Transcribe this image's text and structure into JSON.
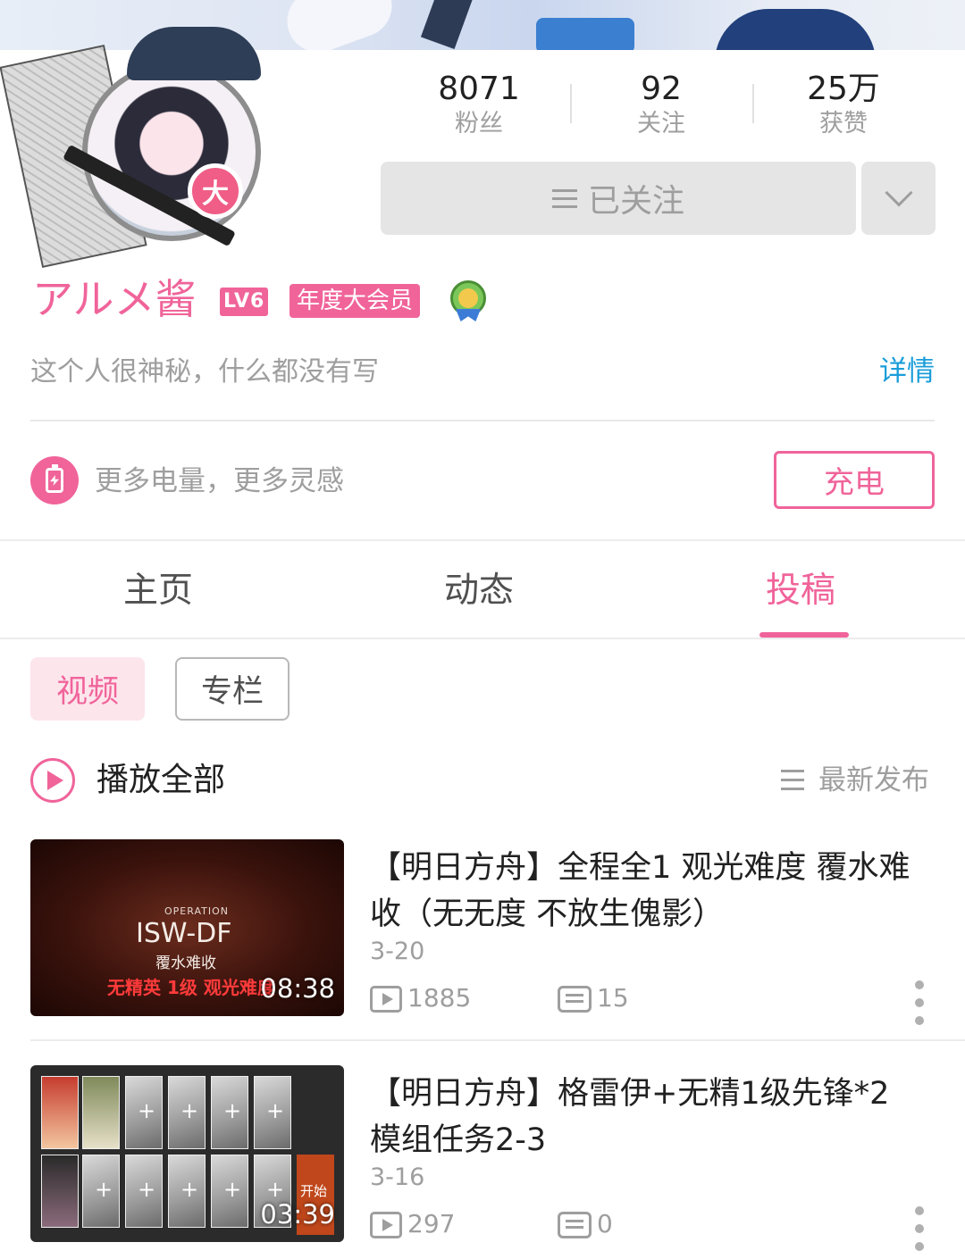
{
  "profile": {
    "avatar_badge": "大",
    "name": "アルメ酱",
    "level": "LV6",
    "vip_tag": "年度大会员",
    "bio": "这个人很神秘，什么都没有写",
    "detail_link": "详情"
  },
  "stats": [
    {
      "value": "8071",
      "label": "粉丝"
    },
    {
      "value": "92",
      "label": "关注"
    },
    {
      "value": "25万",
      "label": "获赞"
    }
  ],
  "follow_button": "已关注",
  "charge": {
    "text": "更多电量，更多灵感",
    "button": "充电"
  },
  "tabs": [
    {
      "label": "主页",
      "active": false
    },
    {
      "label": "动态",
      "active": false
    },
    {
      "label": "投稿",
      "active": true
    }
  ],
  "subtabs": {
    "video": "视频",
    "column": "专栏"
  },
  "play_all": "播放全部",
  "sort_label": "最新发布",
  "videos": [
    {
      "title": "【明日方舟】全程全1 观光难度 覆水难收（无无度 不放生傀影）",
      "date": "3-20",
      "plays": "1885",
      "comments": "15",
      "duration": "08:38",
      "thumb_text": {
        "operation": "OPERATION",
        "code": "ISW-DF",
        "stage": "覆水难收",
        "caption": "无精英 1级 观光难度"
      }
    },
    {
      "title": "【明日方舟】格雷伊+无精1级先锋*2 模组任务2-3",
      "date": "3-16",
      "plays": "297",
      "comments": "0",
      "duration": "03:39",
      "thumb_text": {
        "start": "开始"
      }
    }
  ],
  "colors": {
    "accent": "#f0649a",
    "link": "#1a9dd9",
    "muted": "#9e9e9e"
  }
}
